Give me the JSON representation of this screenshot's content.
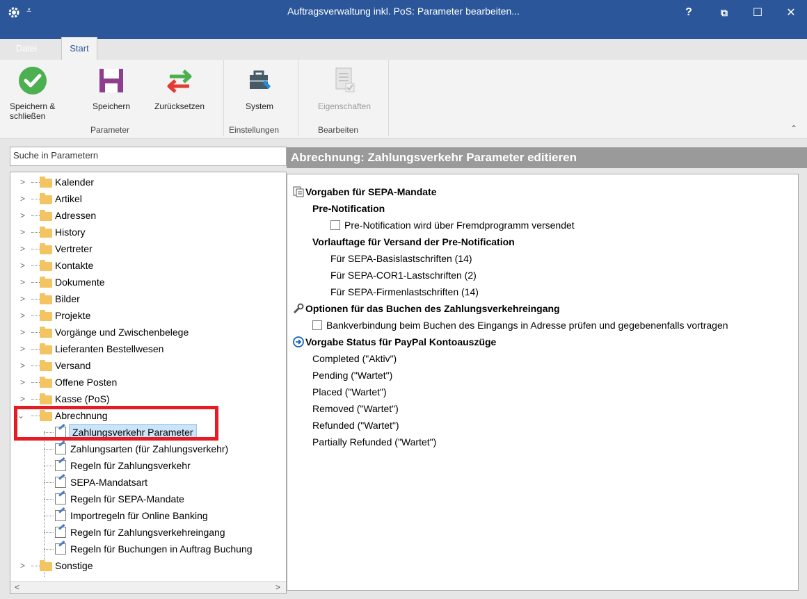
{
  "window": {
    "title": "Auftragsverwaltung inkl. PoS: Parameter bearbeiten...",
    "help_label": "?",
    "restore_label": "⧉",
    "maximize_label": "☐",
    "close_label": "✕"
  },
  "tabs": {
    "datei": "Datei",
    "start": "Start"
  },
  "ribbon": {
    "save_close": "Speichern & schließen",
    "save": "Speichern",
    "reset": "Zurücksetzen",
    "group_parameter": "Parameter",
    "system": "System",
    "group_settings": "Einstellungen",
    "properties": "Eigenschaften",
    "group_edit": "Bearbeiten"
  },
  "search": {
    "placeholder": "Suche in Parametern"
  },
  "tree": {
    "folders": [
      "Kalender",
      "Artikel",
      "Adressen",
      "History",
      "Vertreter",
      "Kontakte",
      "Dokumente",
      "Bilder",
      "Projekte",
      "Vorgänge und Zwischenbelege",
      "Lieferanten Bestellwesen",
      "Versand",
      "Offene Posten",
      "Kasse (PoS)",
      "Abrechnung"
    ],
    "children": [
      "Zahlungsverkehr Parameter",
      "Zahlungsarten (für Zahlungsverkehr)",
      "Regeln für Zahlungsverkehr",
      "SEPA-Mandatsart",
      "Regeln für SEPA-Mandate",
      "Importregeln für Online Banking",
      "Regeln für Zahlungsverkehreingang",
      "Regeln für Buchungen in Auftrag Buchung"
    ],
    "last_folder": "Sonstige"
  },
  "panel": {
    "header": "Abrechnung: Zahlungsverkehr Parameter editieren",
    "sec1": "Vorgaben für SEPA-Mandate",
    "pre_notification": "Pre-Notification",
    "pre_notification_cb": "Pre-Notification wird über Fremdprogramm versendet",
    "vorlauftage": "Vorlauftage für Versand der Pre-Notification",
    "basis": "Für SEPA-Basislastschriften (14)",
    "cor1": "Für SEPA-COR1-Lastschriften (2)",
    "firmen": "Für SEPA-Firmenlastschriften (14)",
    "sec2": "Optionen für das Buchen des Zahlungsverkehreingang",
    "bank_cb": "Bankverbindung beim Buchen des Eingangs in Adresse prüfen und gegebenenfalls vortragen",
    "sec3": "Vorgabe Status für PayPal Kontoauszüge",
    "status": [
      "Completed (\"Aktiv\")",
      "Pending (\"Wartet\")",
      "Placed (\"Wartet\")",
      "Removed (\"Wartet\")",
      "Refunded (\"Wartet\")",
      "Partially Refunded (\"Wartet\")"
    ]
  }
}
